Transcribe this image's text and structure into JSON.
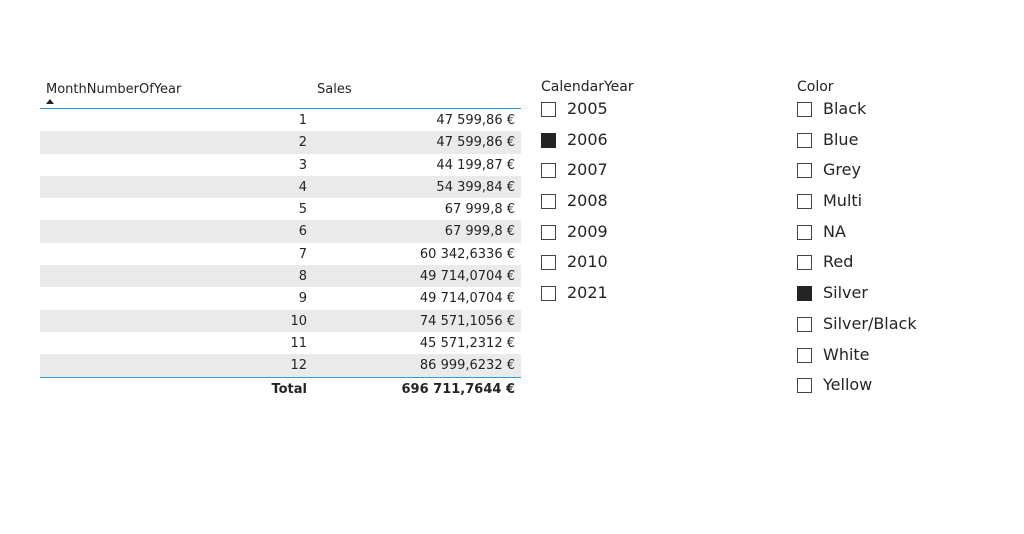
{
  "table": {
    "headers": {
      "month": "MonthNumberOfYear",
      "sales": "Sales"
    },
    "rows": [
      {
        "month": "1",
        "sales": "47 599,86 €"
      },
      {
        "month": "2",
        "sales": "47 599,86 €"
      },
      {
        "month": "3",
        "sales": "44 199,87 €"
      },
      {
        "month": "4",
        "sales": "54 399,84 €"
      },
      {
        "month": "5",
        "sales": "67 999,8 €"
      },
      {
        "month": "6",
        "sales": "67 999,8 €"
      },
      {
        "month": "7",
        "sales": "60 342,6336 €"
      },
      {
        "month": "8",
        "sales": "49 714,0704 €"
      },
      {
        "month": "9",
        "sales": "49 714,0704 €"
      },
      {
        "month": "10",
        "sales": "74 571,1056 €"
      },
      {
        "month": "11",
        "sales": "45 571,2312 €"
      },
      {
        "month": "12",
        "sales": "86 999,6232 €"
      }
    ],
    "total": {
      "label": "Total",
      "sales": "696 711,7644 €"
    },
    "sort_icon": "sort-ascending-icon",
    "accent_color": "#2f9bd8"
  },
  "year_slicer": {
    "title": "CalendarYear",
    "items": [
      {
        "label": "2005",
        "checked": false
      },
      {
        "label": "2006",
        "checked": true
      },
      {
        "label": "2007",
        "checked": false
      },
      {
        "label": "2008",
        "checked": false
      },
      {
        "label": "2009",
        "checked": false
      },
      {
        "label": "2010",
        "checked": false
      },
      {
        "label": "2021",
        "checked": false
      }
    ]
  },
  "color_slicer": {
    "title": "Color",
    "items": [
      {
        "label": "Black",
        "checked": false
      },
      {
        "label": "Blue",
        "checked": false
      },
      {
        "label": "Grey",
        "checked": false
      },
      {
        "label": "Multi",
        "checked": false
      },
      {
        "label": "NA",
        "checked": false
      },
      {
        "label": "Red",
        "checked": false
      },
      {
        "label": "Silver",
        "checked": true
      },
      {
        "label": "Silver/Black",
        "checked": false
      },
      {
        "label": "White",
        "checked": false
      },
      {
        "label": "Yellow",
        "checked": false
      }
    ]
  }
}
